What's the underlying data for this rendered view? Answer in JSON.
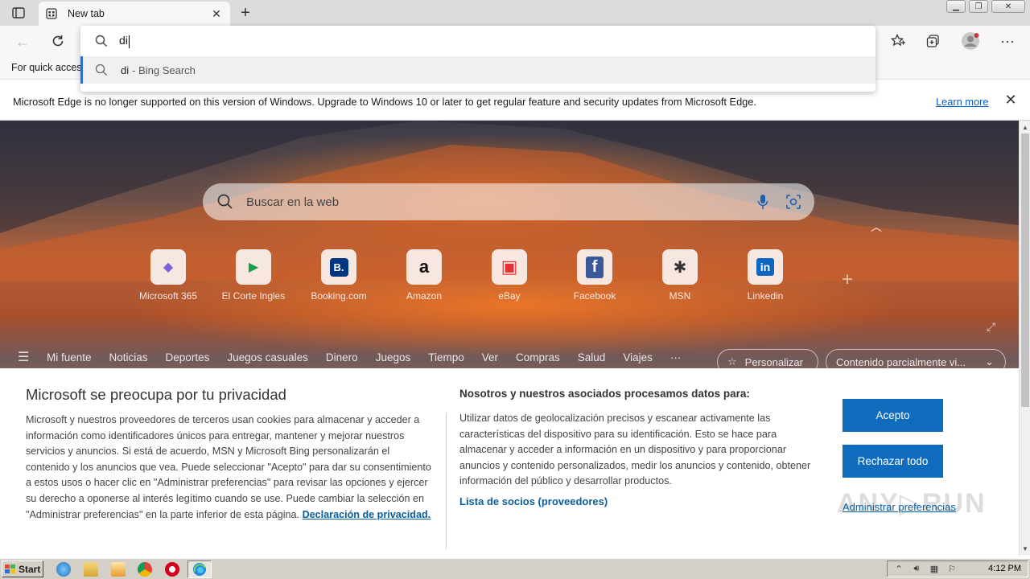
{
  "browser": {
    "tab_title": "New tab",
    "address_value": "di",
    "suggestion": {
      "query": "di",
      "suffix": "- Bing Search"
    },
    "favbar_text": "For quick access"
  },
  "infobar": {
    "message": "Microsoft Edge is no longer supported on this version of Windows. Upgrade to Windows 10 or later to get regular feature and security updates from Microsoft Edge.",
    "learn_more": "Learn more"
  },
  "newtab": {
    "search_placeholder": "Buscar en la web",
    "quicklinks": [
      {
        "label": "Microsoft 365",
        "icon": "microsoft-365-icon",
        "color": "#7b61d9",
        "glyph": "◆"
      },
      {
        "label": "El Corte Ingles",
        "icon": "play-store-icon",
        "color": "#1a9e4a",
        "glyph": "▶"
      },
      {
        "label": "Booking.com",
        "icon": "booking-icon",
        "color": "#003580",
        "glyph": "B."
      },
      {
        "label": "Amazon",
        "icon": "amazon-icon",
        "color": "#111111",
        "glyph": "a"
      },
      {
        "label": "eBay",
        "icon": "ebay-bag-icon",
        "color": "#e53238",
        "glyph": "▣"
      },
      {
        "label": "Facebook",
        "icon": "facebook-icon",
        "color": "#3b5998",
        "glyph": "f"
      },
      {
        "label": "MSN",
        "icon": "msn-icon",
        "color": "#333333",
        "glyph": "✱"
      },
      {
        "label": "Linkedin",
        "icon": "linkedin-icon",
        "color": "#0a66c2",
        "glyph": "in"
      }
    ],
    "feed_nav": [
      "Mi fuente",
      "Noticias",
      "Deportes",
      "Juegos casuales",
      "Dinero",
      "Juegos",
      "Tiempo",
      "Ver",
      "Compras",
      "Salud",
      "Viajes",
      "···"
    ],
    "personalize_label": "Personalizar",
    "content_select_label": "Contenido parcialmente vi..."
  },
  "privacy": {
    "title": "Microsoft se preocupa por tu privacidad",
    "left_body": "Microsoft y nuestros proveedores de terceros usan cookies para almacenar y acceder a información como identificadores únicos para entregar, mantener y mejorar nuestros servicios y anuncios. Si está de acuerdo, MSN y Microsoft Bing personalizarán el contenido y los anuncios que vea. Puede seleccionar \"Acepto\" para dar su consentimiento a estos usos o hacer clic en \"Administrar preferencias\" para revisar las opciones y ejercer su derecho a oponerse al interés legítimo cuando se use. Puede cambiar la selección en \"Administrar preferencias\" en la parte inferior de esta página.",
    "privacy_link": "Declaración de privacidad.",
    "mid_title": "Nosotros y nuestros asociados procesamos datos para:",
    "mid_body": "Utilizar datos de geolocalización precisos y escanear activamente las características del dispositivo para su identificación. Esto se hace para almacenar y acceder a información en un dispositivo y para proporcionar anuncios y contenido personalizados, medir los anuncios y contenido, obtener información del público y desarrollar productos.",
    "partners_link": "Lista de socios (proveedores)",
    "accept_label": "Acepto",
    "reject_label": "Rechazar todo",
    "manage_label": "Administrar preferencias",
    "watermark": "ANY▷RUN"
  },
  "taskbar": {
    "start_label": "Start",
    "clock": "4:12 PM"
  },
  "colors": {
    "accent_blue": "#0f6cbd",
    "link_blue": "#0a5e9e",
    "suggestion_bar": "#2b6fd1"
  }
}
